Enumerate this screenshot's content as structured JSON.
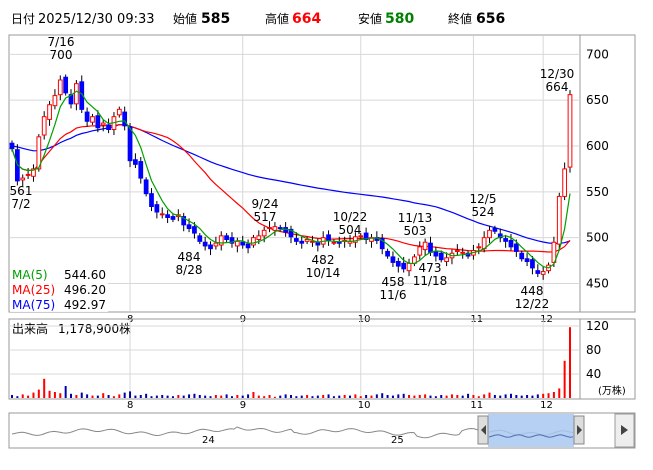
{
  "header": {
    "date_label": "日付",
    "date_value": "2025/12/30 09:33",
    "open_label": "始値",
    "open_value": "585",
    "high_label": "高値",
    "high_value": "664",
    "low_label": "安値",
    "low_value": "580",
    "close_label": "終値",
    "close_value": "656"
  },
  "colors": {
    "up": "#ff0000",
    "down": "#0000ff",
    "ma5": "#00a000",
    "ma25": "#ff0000",
    "ma75": "#0000ff",
    "volume_up": "#ff0000",
    "volume_down": "#0000aa",
    "high_value": "#ff0000",
    "low_value": "#008000",
    "navigator_fill": "#a8c8f0"
  },
  "legend": [
    {
      "key": "ma5",
      "label": "MA(5)",
      "value": "544.60"
    },
    {
      "key": "ma25",
      "label": "MA(25)",
      "value": "496.20"
    },
    {
      "key": "ma75",
      "label": "MA(75)",
      "value": "492.97"
    }
  ],
  "annotations": [
    {
      "date": "7/16",
      "value": "700"
    },
    {
      "date": "7/2",
      "value": "561"
    },
    {
      "date": "8/28",
      "value": "484"
    },
    {
      "date": "9/24",
      "value": "517"
    },
    {
      "date": "10/14",
      "value": "482"
    },
    {
      "date": "10/22",
      "value": "504"
    },
    {
      "date": "11/6",
      "value": "458"
    },
    {
      "date": "11/13",
      "value": "503"
    },
    {
      "date": "11/18",
      "value": "473"
    },
    {
      "date": "12/5",
      "value": "524"
    },
    {
      "date": "12/22",
      "value": "448"
    },
    {
      "date": "12/30",
      "value": "664"
    }
  ],
  "price_ticks": [
    "700",
    "650",
    "600",
    "550",
    "500",
    "450"
  ],
  "month_labels": [
    "8",
    "9",
    "10",
    "11",
    "12"
  ],
  "volume": {
    "title": "出来高",
    "value": "1,178,900株",
    "unit": "(万株)",
    "ticks": [
      "120",
      "80",
      "40"
    ]
  },
  "navigator": {
    "year_labels": [
      "24",
      "25"
    ],
    "left_handle_icon": "chevron-left-icon",
    "right_handle_icon": "chevron-right-icon",
    "scroll_right_icon": "triangle-right-icon"
  },
  "chart_data": {
    "type": "candlestick",
    "price_axis": {
      "range": [
        420,
        720
      ],
      "ticks": [
        700,
        650,
        600,
        550,
        500,
        450
      ]
    },
    "volume_axis": {
      "range": [
        0,
        130
      ],
      "unit": "万株",
      "ticks": [
        120,
        80,
        40
      ]
    },
    "x_months": [
      "8",
      "9",
      "10",
      "11",
      "12"
    ],
    "grid": true,
    "highs_lows": [
      {
        "date": "7/2",
        "value": 561
      },
      {
        "date": "7/16",
        "value": 700
      },
      {
        "date": "8/28",
        "value": 484
      },
      {
        "date": "9/24",
        "value": 517
      },
      {
        "date": "10/14",
        "value": 482
      },
      {
        "date": "10/22",
        "value": 504
      },
      {
        "date": "11/6",
        "value": 458
      },
      {
        "date": "11/13",
        "value": 503
      },
      {
        "date": "11/18",
        "value": 473
      },
      {
        "date": "12/5",
        "value": 524
      },
      {
        "date": "12/22",
        "value": 448
      },
      {
        "date": "12/30",
        "value": 664
      }
    ],
    "ohlc_anchor_closes": [
      597,
      562,
      565,
      569,
      575,
      610,
      632,
      645,
      655,
      672,
      658,
      646,
      668,
      640,
      627,
      632,
      620,
      625,
      618,
      632,
      640,
      622,
      584,
      580,
      565,
      548,
      534,
      528,
      526,
      522,
      520,
      525,
      514,
      510,
      505,
      496,
      491,
      488,
      494,
      502,
      498,
      494,
      496,
      492,
      489,
      500,
      502,
      508,
      511,
      512,
      510,
      506,
      501,
      496,
      494,
      498,
      496,
      492,
      500,
      497,
      495,
      494,
      497,
      496,
      501,
      502,
      498,
      500,
      497,
      488,
      480,
      473,
      469,
      466,
      472,
      479,
      490,
      495,
      484,
      480,
      476,
      478,
      483,
      486,
      484,
      480,
      486,
      490,
      500,
      508,
      507,
      500,
      496,
      490,
      485,
      477,
      474,
      467,
      461,
      463,
      470,
      495,
      545,
      575,
      656
    ],
    "volume_man_shares": [
      5,
      3,
      6,
      4,
      9,
      14,
      32,
      12,
      10,
      8,
      20,
      7,
      5,
      9,
      6,
      4,
      4,
      8,
      5,
      3,
      6,
      9,
      11,
      4,
      5,
      7,
      3,
      4,
      5,
      4,
      3,
      5,
      4,
      6,
      7,
      5,
      4,
      3,
      5,
      4,
      6,
      3,
      5,
      4,
      6,
      10,
      4,
      3,
      5,
      2,
      4,
      6,
      5,
      3,
      4,
      5,
      3,
      4,
      5,
      6,
      3,
      4,
      5,
      4,
      6,
      3,
      5,
      4,
      6,
      8,
      5,
      4,
      6,
      7,
      5,
      4,
      5,
      6,
      4,
      3,
      5,
      4,
      6,
      5,
      4,
      7,
      5,
      3,
      6,
      9,
      5,
      4,
      6,
      7,
      5,
      4,
      5,
      4,
      6,
      7,
      8,
      10,
      16,
      62,
      118
    ],
    "series": [
      {
        "name": "MA(5)",
        "last": 544.6
      },
      {
        "name": "MA(25)",
        "last": 496.2
      },
      {
        "name": "MA(75)",
        "last": 492.97
      }
    ]
  }
}
